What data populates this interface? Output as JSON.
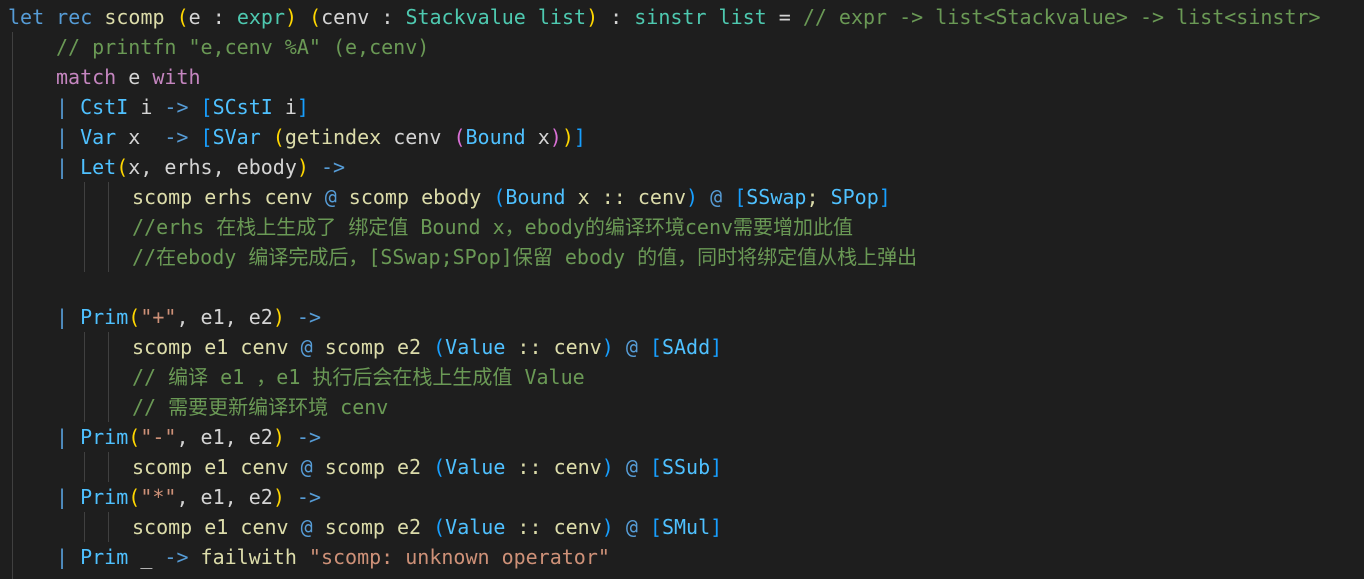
{
  "colors": {
    "background": "#1e1e1e",
    "keyword": "#569cd6",
    "control": "#c586c0",
    "function": "#dcdcaa",
    "type": "#4ec9b0",
    "constructor": "#4fc1ff",
    "string": "#ce9178",
    "comment": "#6a9955",
    "text": "#d4d4d4"
  },
  "code": {
    "l1": {
      "a": "let",
      "b": " ",
      "c": "rec",
      "d": " ",
      "e": "scomp",
      "f": " ",
      "g": "(",
      "h": "e",
      "i": " : ",
      "j": "expr",
      "k": ")",
      "l": " ",
      "m": "(",
      "n": "cenv",
      "o": " : ",
      "p": "Stackvalue list",
      "q": ")",
      "r": " : ",
      "s": "sinstr list",
      "t": " = ",
      "u": "// expr -> list<Stackvalue> -> list<sinstr>"
    },
    "l2": {
      "a": "// printfn \"e,cenv %A\" (e,cenv)"
    },
    "l3": {
      "a": "match",
      "b": " ",
      "c": "e",
      "d": " ",
      "e": "with"
    },
    "l4": {
      "a": "|",
      "b": " ",
      "c": "CstI",
      "d": " ",
      "e": "i",
      "f": " -> ",
      "g": "[",
      "h": "SCstI",
      "i": " ",
      "j": "i",
      "k": "]"
    },
    "l5": {
      "a": "|",
      "b": " ",
      "c": "Var",
      "d": " ",
      "e": "x",
      "f": "  -> ",
      "g": "[",
      "h": "SVar",
      "i": " ",
      "j": "(",
      "k": "getindex",
      "l": " ",
      "m": "cenv",
      "n": " ",
      "o": "(",
      "p": "Bound",
      "q": " ",
      "r": "x",
      "s": ")",
      "t": ")",
      "u": "]"
    },
    "l6": {
      "a": "|",
      "b": " ",
      "c": "Let",
      "d": "(",
      "e": "x",
      "f": ", ",
      "g": "erhs",
      "h": ", ",
      "i": "ebody",
      "j": ")",
      "k": " ->"
    },
    "l7": {
      "a": "scomp",
      "b": " ",
      "c": "erhs",
      "d": " ",
      "e": "cenv",
      "f": " ",
      "g": "@",
      "h": " ",
      "i": "scomp",
      "j": " ",
      "k": "ebody",
      "l": " ",
      "m": "(",
      "n": "Bound",
      "o": " ",
      "p": "x",
      "q": " :: ",
      "r": "cenv",
      "s": ")",
      "t": " ",
      "u": "@",
      "v": " ",
      "w": "[",
      "x": "SSwap",
      "y": "; ",
      "z": "SPop",
      "zz": "]"
    },
    "l8": {
      "a": "//erhs 在栈上生成了 绑定值 Bound x，ebody的编译环境cenv需要增加此值"
    },
    "l9": {
      "a": "//在ebody 编译完成后，[SSwap;SPop]保留 ebody 的值，同时将绑定值从栈上弹出"
    },
    "l11": {
      "a": "|",
      "b": " ",
      "c": "Prim",
      "d": "(",
      "e": "\"+\"",
      "f": ", ",
      "g": "e1",
      "h": ", ",
      "i": "e2",
      "j": ")",
      "k": " ->"
    },
    "l12": {
      "a": "scomp",
      "b": " ",
      "c": "e1",
      "d": " ",
      "e": "cenv",
      "f": " ",
      "g": "@",
      "h": " ",
      "i": "scomp",
      "j": " ",
      "k": "e2",
      "l": " ",
      "m": "(",
      "n": "Value",
      "o": " :: ",
      "p": "cenv",
      "q": ")",
      "r": " ",
      "s": "@",
      "t": " ",
      "u": "[",
      "v": "SAdd",
      "w": "]"
    },
    "l13": {
      "a": "// 编译 e1 ，e1 执行后会在栈上生成值 Value"
    },
    "l14": {
      "a": "// 需要更新编译环境 cenv"
    },
    "l15": {
      "a": "|",
      "b": " ",
      "c": "Prim",
      "d": "(",
      "e": "\"-\"",
      "f": ", ",
      "g": "e1",
      "h": ", ",
      "i": "e2",
      "j": ")",
      "k": " ->"
    },
    "l16": {
      "a": "scomp",
      "b": " ",
      "c": "e1",
      "d": " ",
      "e": "cenv",
      "f": " ",
      "g": "@",
      "h": " ",
      "i": "scomp",
      "j": " ",
      "k": "e2",
      "l": " ",
      "m": "(",
      "n": "Value",
      "o": " :: ",
      "p": "cenv",
      "q": ")",
      "r": " ",
      "s": "@",
      "t": " ",
      "u": "[",
      "v": "SSub",
      "w": "]"
    },
    "l17": {
      "a": "|",
      "b": " ",
      "c": "Prim",
      "d": "(",
      "e": "\"*\"",
      "f": ", ",
      "g": "e1",
      "h": ", ",
      "i": "e2",
      "j": ")",
      "k": " ->"
    },
    "l18": {
      "a": "scomp",
      "b": " ",
      "c": "e1",
      "d": " ",
      "e": "cenv",
      "f": " ",
      "g": "@",
      "h": " ",
      "i": "scomp",
      "j": " ",
      "k": "e2",
      "l": " ",
      "m": "(",
      "n": "Value",
      "o": " :: ",
      "p": "cenv",
      "q": ")",
      "r": " ",
      "s": "@",
      "t": " ",
      "u": "[",
      "v": "SMul",
      "w": "]"
    },
    "l19": {
      "a": "|",
      "b": " ",
      "c": "Prim",
      "d": " ",
      "e": "_",
      "f": " -> ",
      "g": "failwith",
      "h": " ",
      "i": "\"scomp: unknown operator\""
    }
  }
}
